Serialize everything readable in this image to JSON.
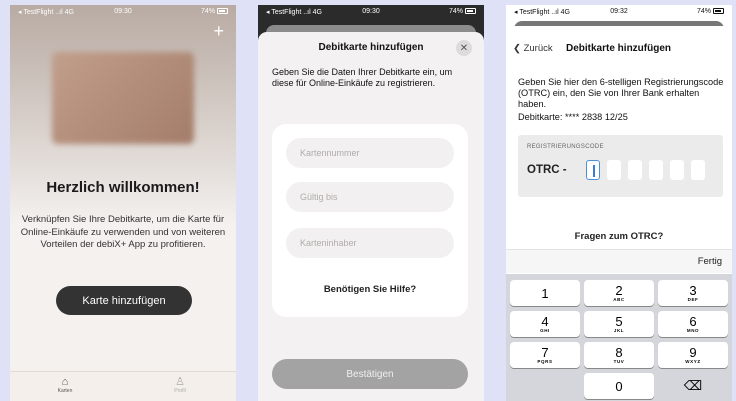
{
  "status": {
    "carrier": "◂ TestFlight ..ıl 4G",
    "times": [
      "09:30",
      "09:30",
      "09:32"
    ],
    "battery": "74%"
  },
  "screen1": {
    "title": "Herzlich willkommen!",
    "description": "Verknüpfen Sie Ihre Debitkarte, um die Karte für Online-Einkäufe zu verwenden und von weiteren Vorteilen der debiX+ App zu profitieren.",
    "add_card_button": "Karte hinzufügen",
    "add_icon": "+",
    "tabs": [
      {
        "label": "Karten",
        "icon": "⌂"
      },
      {
        "label": "Profil",
        "icon": "♙"
      }
    ]
  },
  "screen2": {
    "title": "Debitkarte hinzufügen",
    "close_icon": "✕",
    "intro": "Geben Sie die Daten Ihrer Debitkarte ein, um diese für Online-Einkäufe zu registrieren.",
    "card_number_placeholder": "Kartennummer",
    "valid_until_placeholder": "Gültig bis",
    "card_holder_placeholder": "Karteninhaber",
    "help_link": "Benötigen Sie Hilfe?",
    "confirm_button": "Bestätigen"
  },
  "screen3": {
    "back_label": "❮ Zurück",
    "title": "Debitkarte hinzufügen",
    "intro": "Geben Sie hier den 6-stelligen Registrierungscode (OTRC) ein, den Sie von Ihrer Bank erhalten haben.",
    "card_line": "Debitkarte: **** 2838 12/25",
    "code_label": "REGISTRIERUNGSCODE",
    "code_prefix": "OTRC -",
    "faq_link": "Fragen zum OTRC?",
    "done_button": "Fertig",
    "keys": [
      {
        "num": "1",
        "letters": ""
      },
      {
        "num": "2",
        "letters": "ABC"
      },
      {
        "num": "3",
        "letters": "DEF"
      },
      {
        "num": "4",
        "letters": "GHI"
      },
      {
        "num": "5",
        "letters": "JKL"
      },
      {
        "num": "6",
        "letters": "MNO"
      },
      {
        "num": "7",
        "letters": "PQRS"
      },
      {
        "num": "8",
        "letters": "TUV"
      },
      {
        "num": "9",
        "letters": "WXYZ"
      },
      {
        "num": "0",
        "letters": ""
      }
    ],
    "delete_icon": "⌫"
  }
}
